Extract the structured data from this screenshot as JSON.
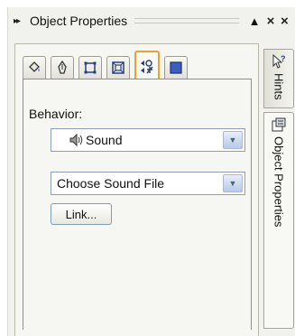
{
  "titlebar": {
    "grip_icon": "grip-arrows-icon",
    "title": "Object Properties",
    "pin_label": "▲",
    "close_label": "×",
    "close2_label": "×"
  },
  "tabs": [
    {
      "name": "fill-tab",
      "icon": "paint-bucket-icon"
    },
    {
      "name": "outline-tab",
      "icon": "pen-nib-icon"
    },
    {
      "name": "size-tab",
      "icon": "frame-icon"
    },
    {
      "name": "position-tab",
      "icon": "expand-frame-icon"
    },
    {
      "name": "internet-tab",
      "icon": "internet-behavior-icon",
      "active": true
    },
    {
      "name": "general-tab",
      "icon": "blue-square-icon"
    }
  ],
  "behavior": {
    "label": "Behavior:",
    "selected": "Sound",
    "icon": "speaker-icon"
  },
  "sound_file": {
    "selected": "Choose Sound File"
  },
  "link_button": "Link...",
  "side_tabs": {
    "hints": "Hints",
    "object_properties": "Object Properties"
  },
  "colors": {
    "active_tab_border": "#f0a030",
    "select_border": "#8e9dbb",
    "panel_bg": "#f1f1ed"
  }
}
